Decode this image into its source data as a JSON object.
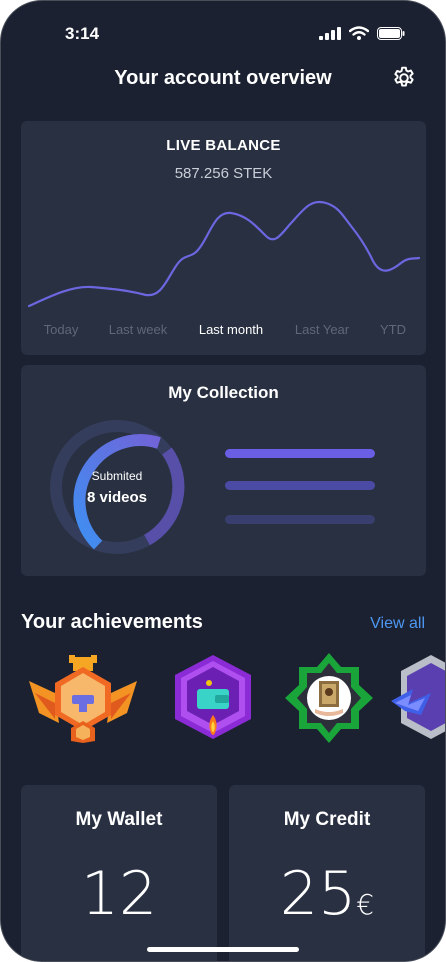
{
  "status_bar": {
    "time": "3:14"
  },
  "header": {
    "title": "Your account overview",
    "settings_icon": "gear-icon"
  },
  "balance": {
    "title": "LIVE BALANCE",
    "value": "587.256 STEK",
    "periods": [
      "Today",
      "Last week",
      "Last month",
      "Last Year",
      "YTD"
    ],
    "active_period": "Last month",
    "line_color": "#6c67e0"
  },
  "collection": {
    "title": "My Collection",
    "donut_caption": "Submited",
    "donut_value": "8 videos",
    "colors": [
      "#4d8df0",
      "#6a5fd6",
      "#3a4468"
    ]
  },
  "achievements": {
    "title": "Your achievements",
    "view_all": "View all",
    "badges": [
      "crown-anvil-badge",
      "wallet-hexagon-badge",
      "framed-portrait-badge",
      "lightning-badge"
    ]
  },
  "wallet": {
    "label": "My Wallet",
    "value": "12"
  },
  "credit": {
    "label": "My Credit",
    "value": "25",
    "currency": "€"
  }
}
